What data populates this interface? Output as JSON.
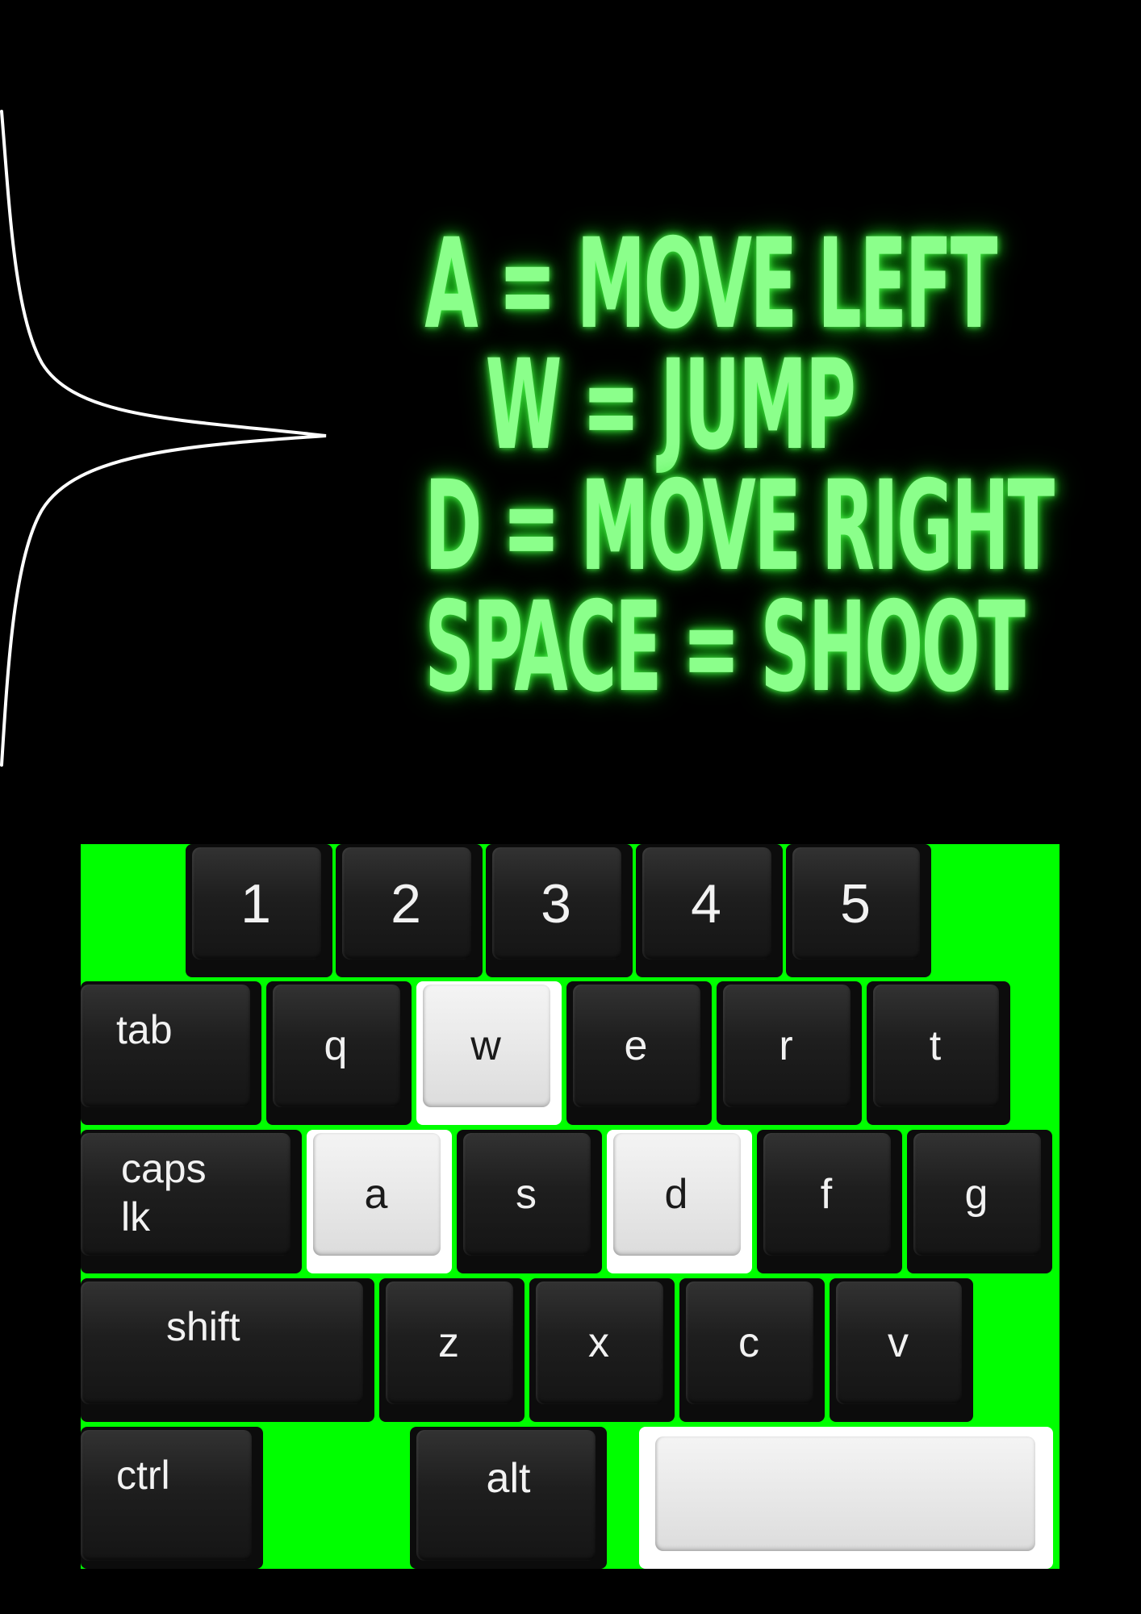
{
  "controls": [
    "A =  MOVE LEFT",
    "W = JUMP",
    "D = MOVE RIGHT",
    "SPACE = SHOOT"
  ],
  "colors": {
    "background": "#000000",
    "glow_text": "#8bff8b",
    "keyboard_background": "#00ff00",
    "highlight_key": "#ffffff",
    "dark_key": "#1e1e1e"
  },
  "keyboard": {
    "number_row": [
      "1",
      "2",
      "3",
      "4",
      "5"
    ],
    "top_row": [
      "tab",
      "q",
      "w",
      "e",
      "r",
      "t"
    ],
    "home_row": [
      "caps\nlk",
      "a",
      "s",
      "d",
      "f",
      "g"
    ],
    "bottom_row": [
      "shift",
      "z",
      "x",
      "c",
      "v"
    ],
    "space_row": [
      "ctrl",
      "alt",
      ""
    ],
    "highlighted_keys": [
      "w",
      "a",
      "d",
      "space"
    ]
  }
}
